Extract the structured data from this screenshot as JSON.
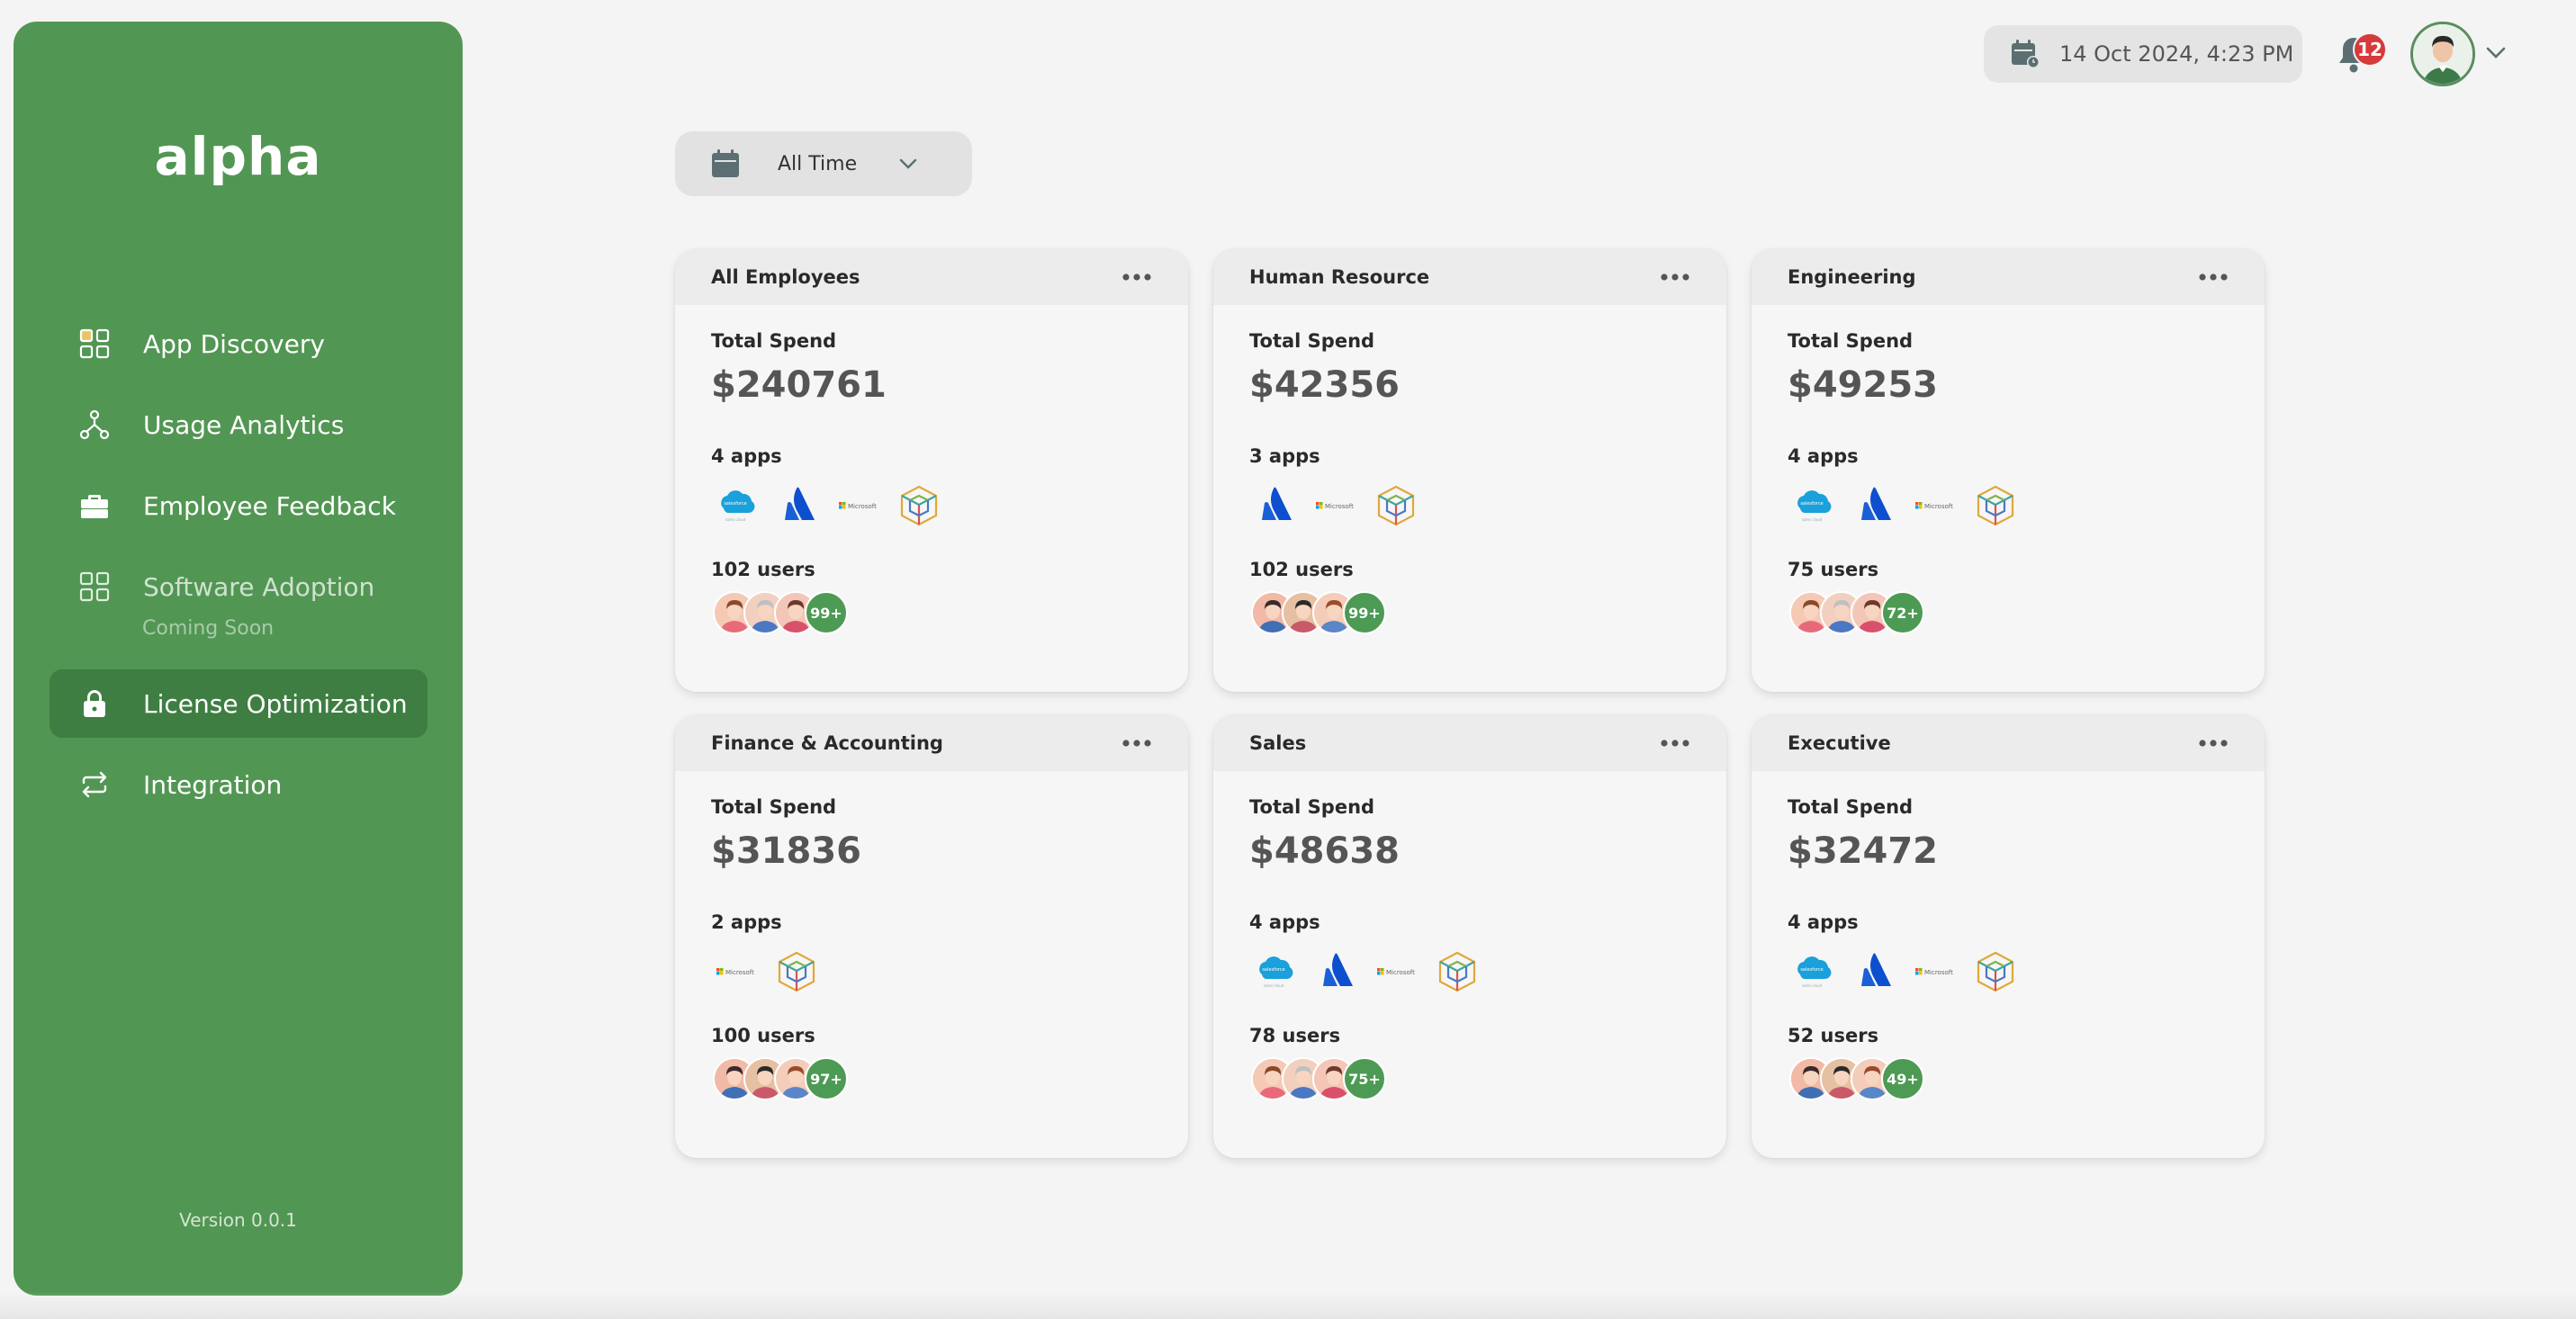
{
  "brand": {
    "logo_text": "alpha",
    "version": "Version 0.0.1"
  },
  "sidebar": {
    "items": [
      {
        "label": "App Discovery",
        "icon": "grid-discovery-icon"
      },
      {
        "label": "Usage Analytics",
        "icon": "network-icon"
      },
      {
        "label": "Employee Feedback",
        "icon": "briefcase-icon"
      },
      {
        "label": "Software Adoption",
        "icon": "grid-icon",
        "note": "Coming Soon"
      },
      {
        "label": "License Optimization",
        "icon": "lock-icon",
        "active": true
      },
      {
        "label": "Integration",
        "icon": "sync-icon"
      }
    ]
  },
  "topbar": {
    "datetime": "14 Oct 2024, 4:23 PM",
    "notifications_count": "12"
  },
  "filter": {
    "selected": "All Time"
  },
  "labels": {
    "total_spend": "Total Spend"
  },
  "colors": {
    "sidebar": "#529653",
    "active_item": "#3e7e42",
    "badge": "#d63a3a",
    "more_users": "#4d9a54"
  },
  "cards": [
    {
      "title": "All Employees",
      "total_spend": "$240761",
      "apps_label": "4 apps",
      "apps": [
        "salesforce",
        "atlassian",
        "microsoft",
        "cube"
      ],
      "users_label": "102 users",
      "more_users": "99+"
    },
    {
      "title": "Human Resource",
      "total_spend": "$42356",
      "apps_label": "3 apps",
      "apps": [
        "atlassian",
        "microsoft",
        "cube"
      ],
      "users_label": "102 users",
      "more_users": "99+"
    },
    {
      "title": "Engineering",
      "total_spend": "$49253",
      "apps_label": "4 apps",
      "apps": [
        "salesforce",
        "atlassian",
        "microsoft",
        "cube"
      ],
      "users_label": "75 users",
      "more_users": "72+"
    },
    {
      "title": "Finance & Accounting",
      "total_spend": "$31836",
      "apps_label": "2 apps",
      "apps": [
        "microsoft",
        "cube"
      ],
      "users_label": "100 users",
      "more_users": "97+"
    },
    {
      "title": "Sales",
      "total_spend": "$48638",
      "apps_label": "4 apps",
      "apps": [
        "salesforce",
        "atlassian",
        "microsoft",
        "cube"
      ],
      "users_label": "78 users",
      "more_users": "75+"
    },
    {
      "title": "Executive",
      "total_spend": "$32472",
      "apps_label": "4 apps",
      "apps": [
        "salesforce",
        "atlassian",
        "microsoft",
        "cube"
      ],
      "users_label": "52 users",
      "more_users": "49+"
    }
  ]
}
